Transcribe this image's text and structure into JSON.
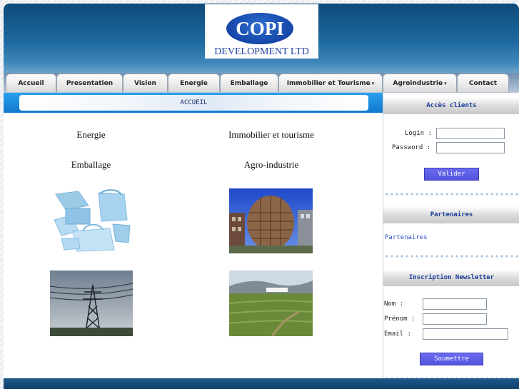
{
  "logo": {
    "mark": "COPI",
    "subtitle": "DEVELOPMENT LTD"
  },
  "nav": {
    "items": [
      {
        "label": "Accueil",
        "dropdown": false
      },
      {
        "label": "Presentation",
        "dropdown": false
      },
      {
        "label": "Vision",
        "dropdown": false
      },
      {
        "label": "Energie",
        "dropdown": false
      },
      {
        "label": "Emballage",
        "dropdown": false
      },
      {
        "label": "Immobilier et Tourisme",
        "dropdown": true
      },
      {
        "label": "Agroindustrie",
        "dropdown": true
      },
      {
        "label": "Contact",
        "dropdown": false
      }
    ],
    "dropdown_glyph": "▾"
  },
  "main": {
    "page_title": "ACCUEIL",
    "categories": [
      "Energie",
      "Immobilier et tourisme",
      "Emballage",
      "Agro-industrie"
    ],
    "images": [
      "packaging-bags-image",
      "egg-building-image",
      "power-pylon-image",
      "agriculture-field-image"
    ]
  },
  "sidebar": {
    "client_access": {
      "heading": "Accès clients",
      "login_label": "Login :",
      "password_label": "Password :",
      "login_value": "",
      "password_value": "",
      "submit_label": "Valider"
    },
    "partners": {
      "heading": "Partenaires",
      "link_label": "Partenaires"
    },
    "newsletter": {
      "heading": "Inscription Newsletter",
      "nom_label": "Nom :",
      "prenom_label": "Prénom :",
      "email_label": "Email :",
      "nom_value": "",
      "prenom_value": "",
      "email_value": "",
      "submit_label": "Soumettre"
    }
  },
  "colors": {
    "header_blue": "#1e6aa0",
    "accent_blue": "#1278cc",
    "button_violet": "#5c5ce6",
    "heading_text": "#1b3d9a",
    "link_blue": "#2e4fcf"
  }
}
